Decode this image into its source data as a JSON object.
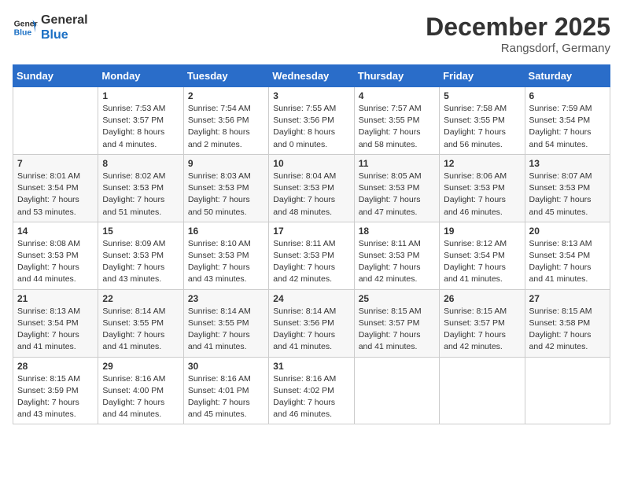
{
  "header": {
    "logo_line1": "General",
    "logo_line2": "Blue",
    "month_year": "December 2025",
    "location": "Rangsdorf, Germany"
  },
  "weekdays": [
    "Sunday",
    "Monday",
    "Tuesday",
    "Wednesday",
    "Thursday",
    "Friday",
    "Saturday"
  ],
  "weeks": [
    [
      {
        "day": "",
        "sunrise": "",
        "sunset": "",
        "daylight": ""
      },
      {
        "day": "1",
        "sunrise": "Sunrise: 7:53 AM",
        "sunset": "Sunset: 3:57 PM",
        "daylight": "Daylight: 8 hours and 4 minutes."
      },
      {
        "day": "2",
        "sunrise": "Sunrise: 7:54 AM",
        "sunset": "Sunset: 3:56 PM",
        "daylight": "Daylight: 8 hours and 2 minutes."
      },
      {
        "day": "3",
        "sunrise": "Sunrise: 7:55 AM",
        "sunset": "Sunset: 3:56 PM",
        "daylight": "Daylight: 8 hours and 0 minutes."
      },
      {
        "day": "4",
        "sunrise": "Sunrise: 7:57 AM",
        "sunset": "Sunset: 3:55 PM",
        "daylight": "Daylight: 7 hours and 58 minutes."
      },
      {
        "day": "5",
        "sunrise": "Sunrise: 7:58 AM",
        "sunset": "Sunset: 3:55 PM",
        "daylight": "Daylight: 7 hours and 56 minutes."
      },
      {
        "day": "6",
        "sunrise": "Sunrise: 7:59 AM",
        "sunset": "Sunset: 3:54 PM",
        "daylight": "Daylight: 7 hours and 54 minutes."
      }
    ],
    [
      {
        "day": "7",
        "sunrise": "Sunrise: 8:01 AM",
        "sunset": "Sunset: 3:54 PM",
        "daylight": "Daylight: 7 hours and 53 minutes."
      },
      {
        "day": "8",
        "sunrise": "Sunrise: 8:02 AM",
        "sunset": "Sunset: 3:53 PM",
        "daylight": "Daylight: 7 hours and 51 minutes."
      },
      {
        "day": "9",
        "sunrise": "Sunrise: 8:03 AM",
        "sunset": "Sunset: 3:53 PM",
        "daylight": "Daylight: 7 hours and 50 minutes."
      },
      {
        "day": "10",
        "sunrise": "Sunrise: 8:04 AM",
        "sunset": "Sunset: 3:53 PM",
        "daylight": "Daylight: 7 hours and 48 minutes."
      },
      {
        "day": "11",
        "sunrise": "Sunrise: 8:05 AM",
        "sunset": "Sunset: 3:53 PM",
        "daylight": "Daylight: 7 hours and 47 minutes."
      },
      {
        "day": "12",
        "sunrise": "Sunrise: 8:06 AM",
        "sunset": "Sunset: 3:53 PM",
        "daylight": "Daylight: 7 hours and 46 minutes."
      },
      {
        "day": "13",
        "sunrise": "Sunrise: 8:07 AM",
        "sunset": "Sunset: 3:53 PM",
        "daylight": "Daylight: 7 hours and 45 minutes."
      }
    ],
    [
      {
        "day": "14",
        "sunrise": "Sunrise: 8:08 AM",
        "sunset": "Sunset: 3:53 PM",
        "daylight": "Daylight: 7 hours and 44 minutes."
      },
      {
        "day": "15",
        "sunrise": "Sunrise: 8:09 AM",
        "sunset": "Sunset: 3:53 PM",
        "daylight": "Daylight: 7 hours and 43 minutes."
      },
      {
        "day": "16",
        "sunrise": "Sunrise: 8:10 AM",
        "sunset": "Sunset: 3:53 PM",
        "daylight": "Daylight: 7 hours and 43 minutes."
      },
      {
        "day": "17",
        "sunrise": "Sunrise: 8:11 AM",
        "sunset": "Sunset: 3:53 PM",
        "daylight": "Daylight: 7 hours and 42 minutes."
      },
      {
        "day": "18",
        "sunrise": "Sunrise: 8:11 AM",
        "sunset": "Sunset: 3:53 PM",
        "daylight": "Daylight: 7 hours and 42 minutes."
      },
      {
        "day": "19",
        "sunrise": "Sunrise: 8:12 AM",
        "sunset": "Sunset: 3:54 PM",
        "daylight": "Daylight: 7 hours and 41 minutes."
      },
      {
        "day": "20",
        "sunrise": "Sunrise: 8:13 AM",
        "sunset": "Sunset: 3:54 PM",
        "daylight": "Daylight: 7 hours and 41 minutes."
      }
    ],
    [
      {
        "day": "21",
        "sunrise": "Sunrise: 8:13 AM",
        "sunset": "Sunset: 3:54 PM",
        "daylight": "Daylight: 7 hours and 41 minutes."
      },
      {
        "day": "22",
        "sunrise": "Sunrise: 8:14 AM",
        "sunset": "Sunset: 3:55 PM",
        "daylight": "Daylight: 7 hours and 41 minutes."
      },
      {
        "day": "23",
        "sunrise": "Sunrise: 8:14 AM",
        "sunset": "Sunset: 3:55 PM",
        "daylight": "Daylight: 7 hours and 41 minutes."
      },
      {
        "day": "24",
        "sunrise": "Sunrise: 8:14 AM",
        "sunset": "Sunset: 3:56 PM",
        "daylight": "Daylight: 7 hours and 41 minutes."
      },
      {
        "day": "25",
        "sunrise": "Sunrise: 8:15 AM",
        "sunset": "Sunset: 3:57 PM",
        "daylight": "Daylight: 7 hours and 41 minutes."
      },
      {
        "day": "26",
        "sunrise": "Sunrise: 8:15 AM",
        "sunset": "Sunset: 3:57 PM",
        "daylight": "Daylight: 7 hours and 42 minutes."
      },
      {
        "day": "27",
        "sunrise": "Sunrise: 8:15 AM",
        "sunset": "Sunset: 3:58 PM",
        "daylight": "Daylight: 7 hours and 42 minutes."
      }
    ],
    [
      {
        "day": "28",
        "sunrise": "Sunrise: 8:15 AM",
        "sunset": "Sunset: 3:59 PM",
        "daylight": "Daylight: 7 hours and 43 minutes."
      },
      {
        "day": "29",
        "sunrise": "Sunrise: 8:16 AM",
        "sunset": "Sunset: 4:00 PM",
        "daylight": "Daylight: 7 hours and 44 minutes."
      },
      {
        "day": "30",
        "sunrise": "Sunrise: 8:16 AM",
        "sunset": "Sunset: 4:01 PM",
        "daylight": "Daylight: 7 hours and 45 minutes."
      },
      {
        "day": "31",
        "sunrise": "Sunrise: 8:16 AM",
        "sunset": "Sunset: 4:02 PM",
        "daylight": "Daylight: 7 hours and 46 minutes."
      },
      {
        "day": "",
        "sunrise": "",
        "sunset": "",
        "daylight": ""
      },
      {
        "day": "",
        "sunrise": "",
        "sunset": "",
        "daylight": ""
      },
      {
        "day": "",
        "sunrise": "",
        "sunset": "",
        "daylight": ""
      }
    ]
  ]
}
